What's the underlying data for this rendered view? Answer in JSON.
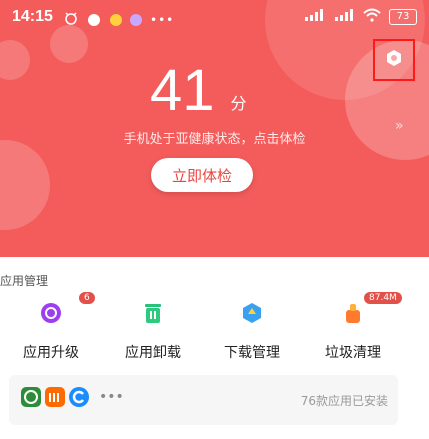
{
  "status_bar": {
    "time": "14:15",
    "battery": "73"
  },
  "header": {
    "score": "41",
    "score_unit": "分",
    "health_text": "手机处于亚健康状态，点击体检",
    "check_button": "立即体检",
    "settings_icon": "gear-icon"
  },
  "apps": {
    "section_title": "应用管理",
    "tools": [
      {
        "label": "应用升级",
        "icon": "upgrade-icon",
        "badge": "6"
      },
      {
        "label": "应用卸载",
        "icon": "uninstall-icon"
      },
      {
        "label": "下载管理",
        "icon": "download-icon"
      },
      {
        "label": "垃圾清理",
        "icon": "clean-icon",
        "badge": "87.4M"
      }
    ],
    "installed_count": "76款应用已安装"
  },
  "colors": {
    "hero": "#f45c5c",
    "badge": "#e2504a",
    "accent": "#e9463f"
  }
}
